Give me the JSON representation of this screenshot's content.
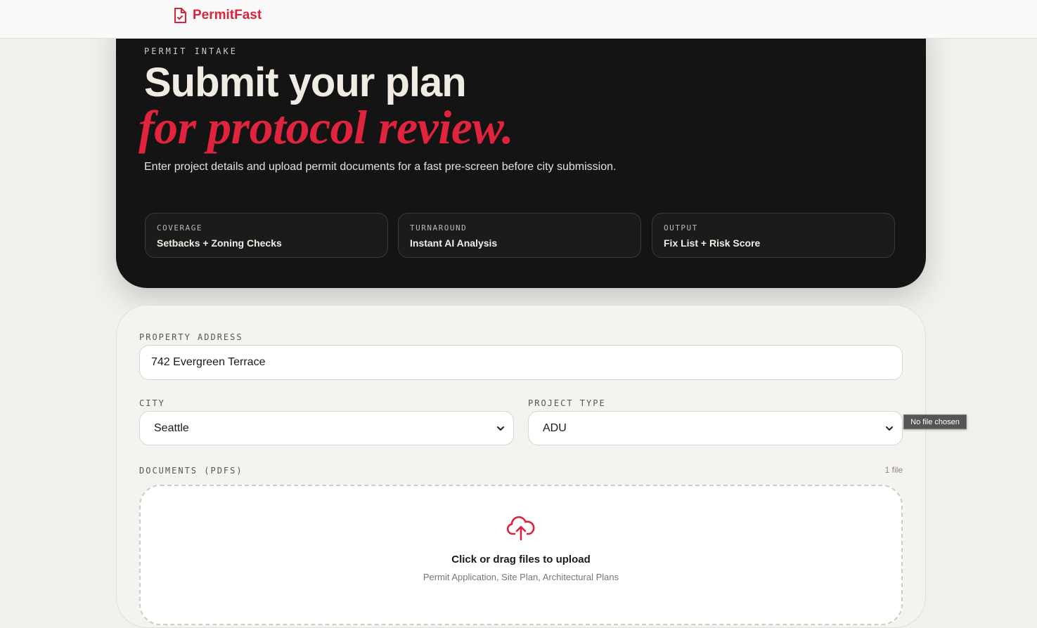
{
  "brand": {
    "name": "PermitFast"
  },
  "hero": {
    "eyebrow": "PERMIT INTAKE",
    "title_line1": "Submit your plan",
    "title_line2": "for protocol review.",
    "description": "Enter project details and upload permit documents for a fast pre-screen before city submission.",
    "stats": [
      {
        "label": "COVERAGE",
        "value": "Setbacks + Zoning Checks"
      },
      {
        "label": "TURNAROUND",
        "value": "Instant AI Analysis"
      },
      {
        "label": "OUTPUT",
        "value": "Fix List + Risk Score"
      }
    ]
  },
  "form": {
    "address": {
      "label": "PROPERTY ADDRESS",
      "value": "742 Evergreen Terrace"
    },
    "city": {
      "label": "CITY",
      "selected": "Seattle"
    },
    "project_type": {
      "label": "PROJECT TYPE",
      "selected": "ADU"
    },
    "documents": {
      "label": "DOCUMENTS (PDFS)",
      "count": "1 file",
      "upload_title": "Click or drag files to upload",
      "upload_hint": "Permit Application, Site Plan, Architectural Plans"
    }
  },
  "tooltip": {
    "text": "No file chosen"
  },
  "colors": {
    "accent": "#e0243e",
    "hero_bg": "#141414",
    "page_bg": "#f2f0ec"
  },
  "icons": [
    "file-check-icon",
    "chevron-down-icon",
    "cloud-upload-icon"
  ]
}
